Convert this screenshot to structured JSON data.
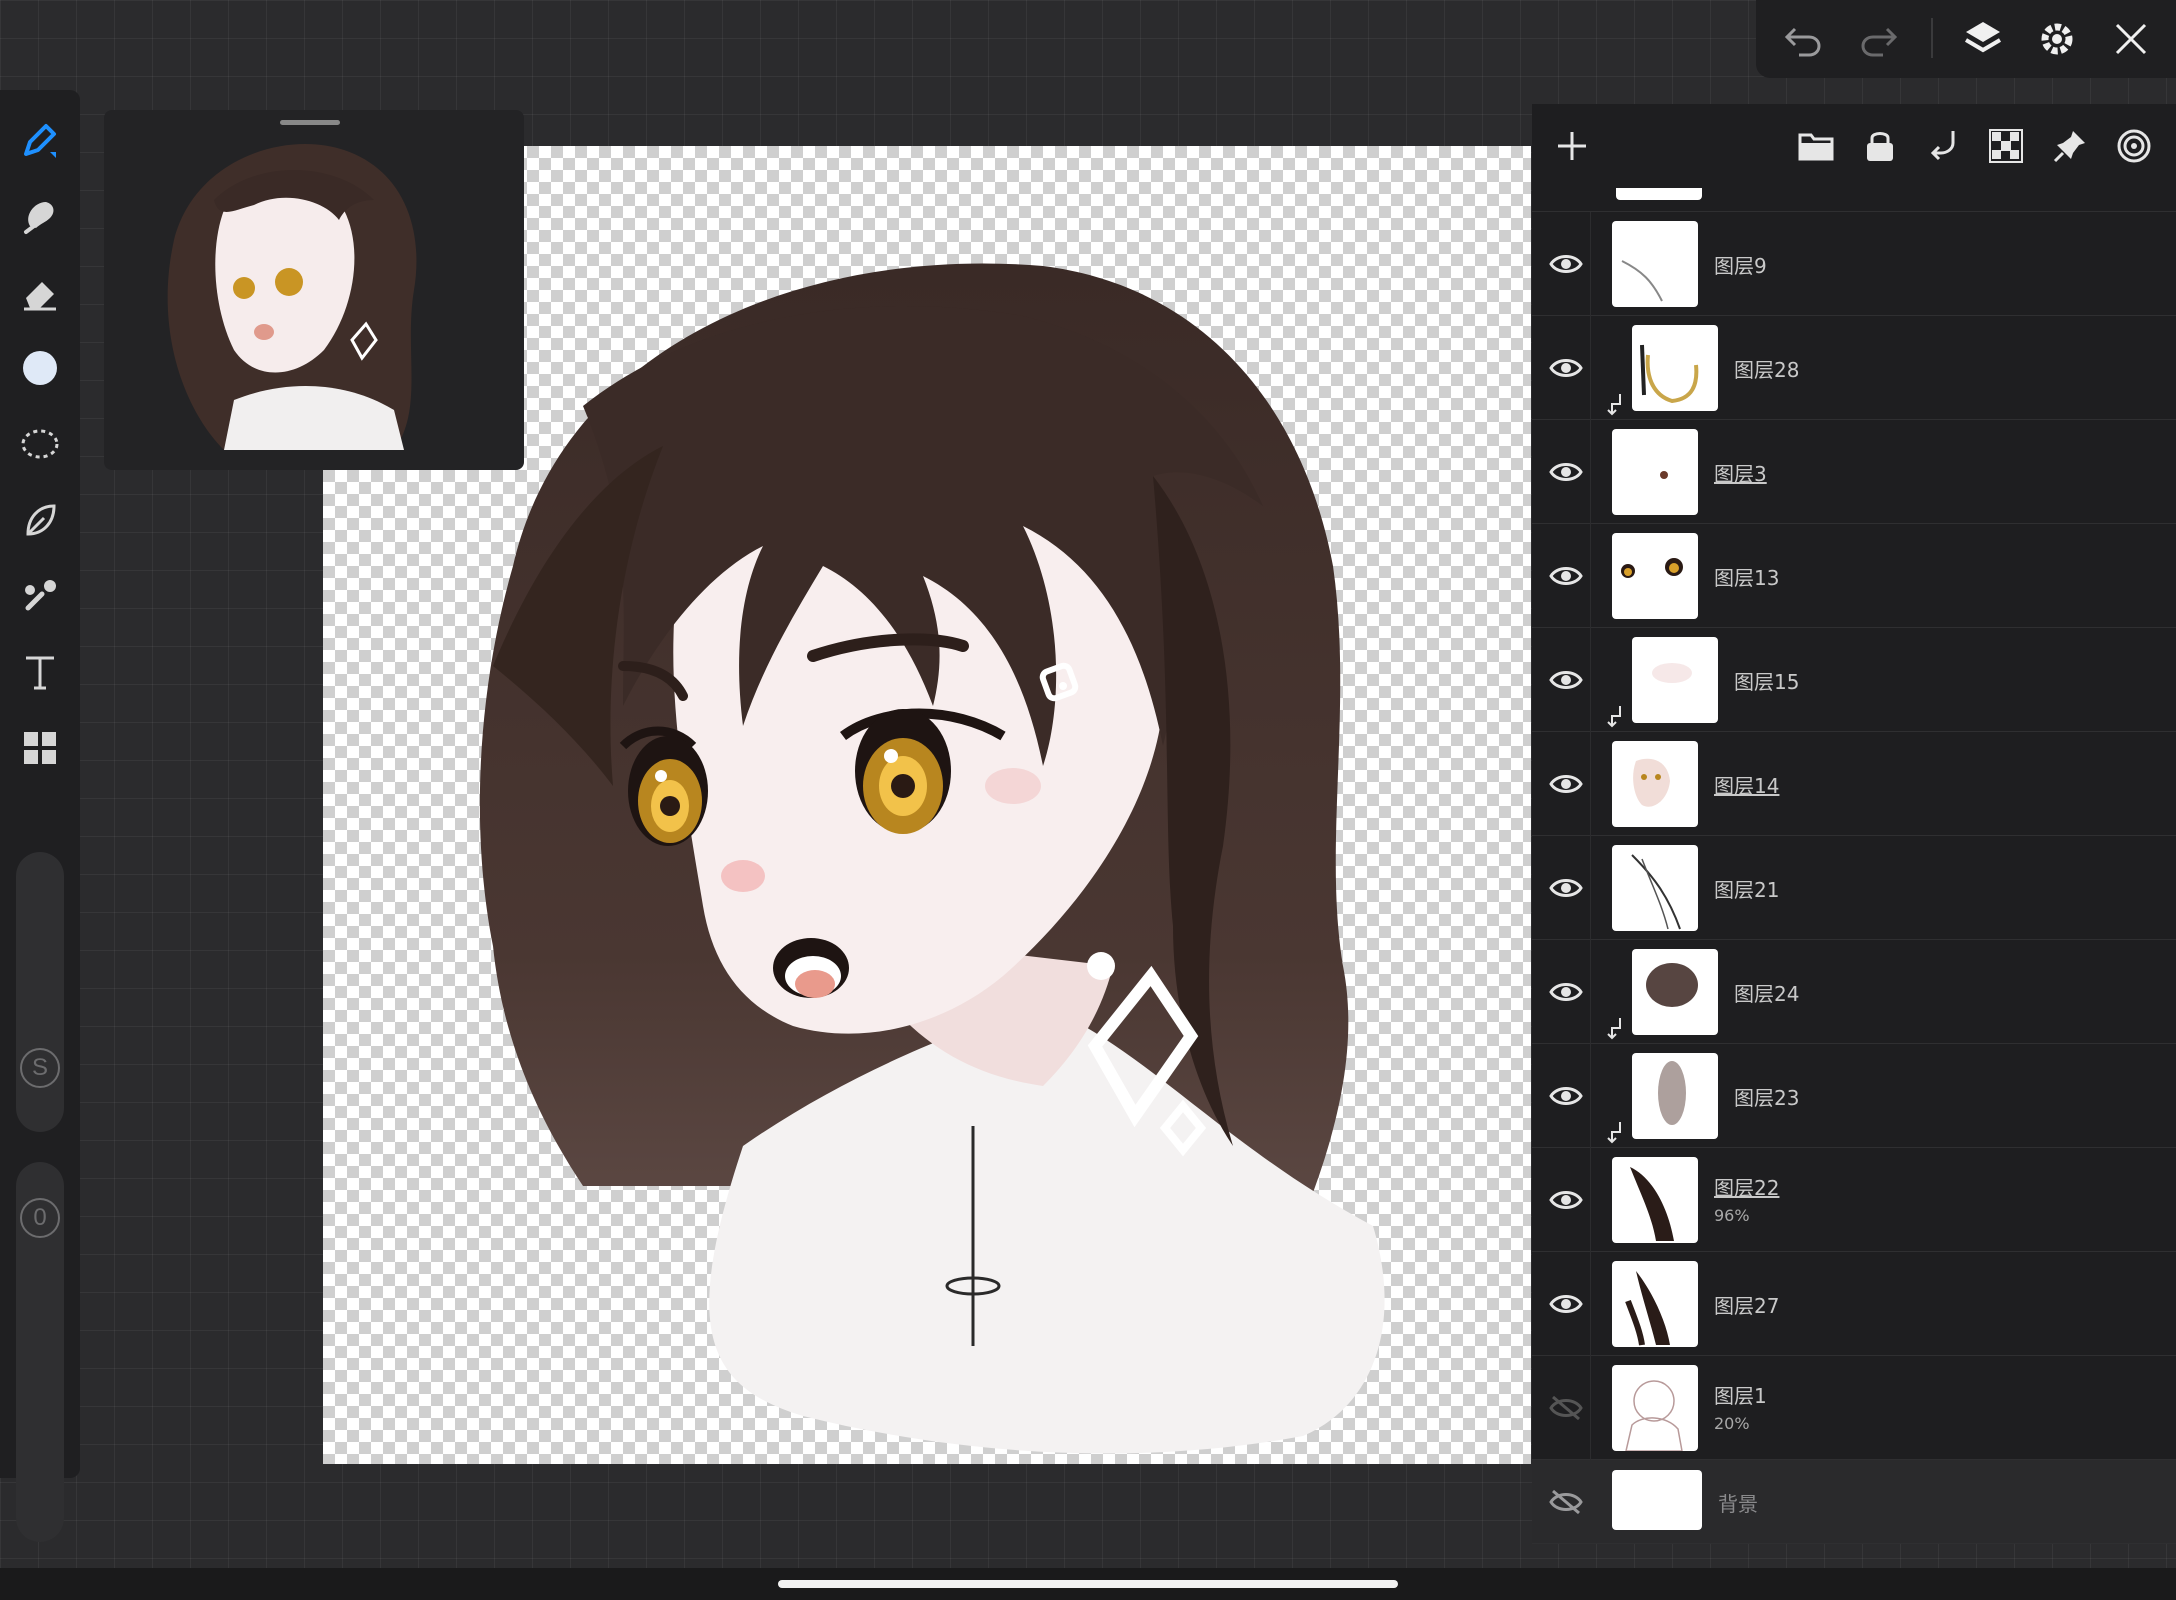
{
  "app": {
    "accent": "#1e90ff"
  },
  "toolbar": {
    "tools": [
      "pen-icon",
      "smudge-icon",
      "eraser-icon",
      "color-icon",
      "lasso-select-icon",
      "fill-icon",
      "eyedropper-icon",
      "text-icon",
      "apps-grid-icon"
    ],
    "active_tool": "pen-icon",
    "active_color": "#dfe9f7",
    "size_slider_label": "S",
    "opacity_slider_label": "0"
  },
  "topbar": {
    "icons": [
      "undo-icon",
      "redo-icon",
      "layers-icon",
      "settings-icon",
      "close-icon"
    ]
  },
  "layer_toolbar": {
    "icons": [
      "add-layer-icon",
      "folder-icon",
      "lock-icon",
      "clip-icon",
      "alpha-lock-icon",
      "pin-icon",
      "reference-icon"
    ]
  },
  "layers": [
    {
      "name": "图层9",
      "visible": true,
      "clipped": false,
      "underline": false,
      "opacity": ""
    },
    {
      "name": "图层28",
      "visible": true,
      "clipped": true,
      "underline": false,
      "opacity": ""
    },
    {
      "name": "图层3",
      "visible": true,
      "clipped": false,
      "underline": true,
      "opacity": ""
    },
    {
      "name": "图层13",
      "visible": true,
      "clipped": false,
      "underline": false,
      "opacity": ""
    },
    {
      "name": "图层15",
      "visible": true,
      "clipped": true,
      "underline": false,
      "opacity": ""
    },
    {
      "name": "图层14",
      "visible": true,
      "clipped": false,
      "underline": true,
      "opacity": ""
    },
    {
      "name": "图层21",
      "visible": true,
      "clipped": false,
      "underline": false,
      "opacity": ""
    },
    {
      "name": "图层24",
      "visible": true,
      "clipped": true,
      "underline": false,
      "opacity": ""
    },
    {
      "name": "图层23",
      "visible": true,
      "clipped": true,
      "underline": false,
      "opacity": ""
    },
    {
      "name": "图层22",
      "visible": true,
      "clipped": false,
      "underline": true,
      "opacity": "96%"
    },
    {
      "name": "图层27",
      "visible": true,
      "clipped": false,
      "underline": false,
      "opacity": ""
    },
    {
      "name": "图层1",
      "visible": false,
      "clipped": false,
      "underline": false,
      "opacity": "20%"
    },
    {
      "name": "背景",
      "visible": false,
      "clipped": false,
      "underline": false,
      "opacity": ""
    }
  ]
}
